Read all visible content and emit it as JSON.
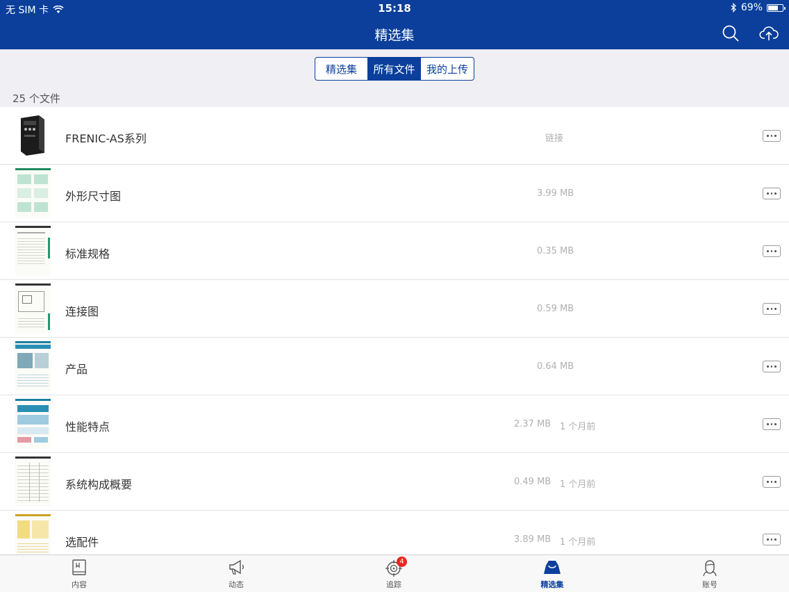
{
  "status_bar": {
    "carrier": "无 SIM 卡",
    "time": "15:18",
    "battery": "69%",
    "battery_level": 0.69
  },
  "header": {
    "title": "精选集",
    "icons": [
      "search-icon",
      "cloud-upload-icon"
    ]
  },
  "segments": [
    {
      "label": "精选集",
      "active": false
    },
    {
      "label": "所有文件",
      "active": true
    },
    {
      "label": "我的上传",
      "active": false
    }
  ],
  "file_count": "25 个文件",
  "files": [
    {
      "name": "FRENIC-AS系列",
      "size": "链接",
      "date": ""
    },
    {
      "name": "外形尺寸图",
      "size": "3.99 MB",
      "date": ""
    },
    {
      "name": "标准规格",
      "size": "0.35 MB",
      "date": ""
    },
    {
      "name": "连接图",
      "size": "0.59 MB",
      "date": ""
    },
    {
      "name": "产品",
      "size": "0.64 MB",
      "date": ""
    },
    {
      "name": "性能特点",
      "size": "2.37 MB",
      "date": "1 个月前"
    },
    {
      "name": "系统构成概要",
      "size": "0.49 MB",
      "date": "1 个月前"
    },
    {
      "name": "选配件",
      "size": "3.89 MB",
      "date": "1 个月前"
    }
  ],
  "tabs": [
    {
      "label": "内容",
      "icon": "book-icon",
      "active": false
    },
    {
      "label": "动态",
      "icon": "megaphone-icon",
      "active": false
    },
    {
      "label": "追踪",
      "icon": "target-icon",
      "active": false,
      "badge": "4"
    },
    {
      "label": "精选集",
      "icon": "collection-icon",
      "active": true
    },
    {
      "label": "账号",
      "icon": "user-icon",
      "active": false
    }
  ],
  "colors": {
    "brand": "#0b3f9b",
    "badge": "#e8271f"
  }
}
